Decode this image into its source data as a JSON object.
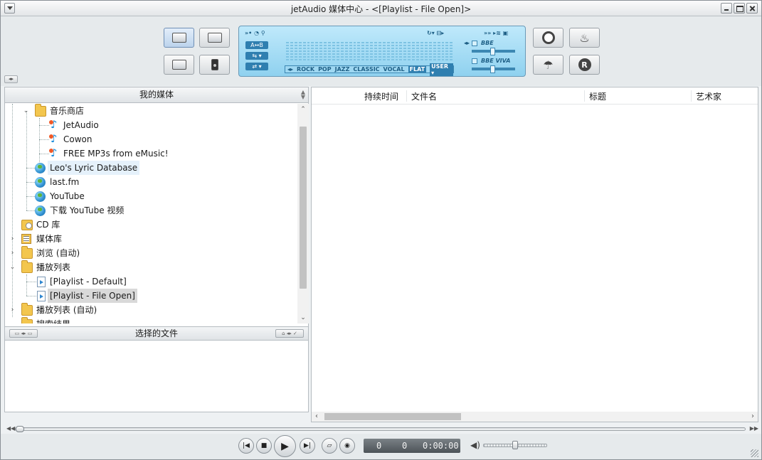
{
  "window": {
    "title": "jetAudio 媒体中心 - <[Playlist - File Open]>"
  },
  "lcd": {
    "ab_label": "A↔B",
    "eq_presets": [
      "ROCK",
      "POP",
      "JAZZ",
      "CLASSIC",
      "VOCAL",
      "FLAT",
      "USER ▾"
    ],
    "eq_selected": "FLAT",
    "bbe_label": "BBE",
    "bbe_viva_label": "BBE VIVA"
  },
  "left_panel": {
    "header": "我的媒体",
    "tree": [
      {
        "label": "音乐商店",
        "icon": "music-store-folder-icon",
        "expanded": true
      },
      {
        "label": "JetAudio",
        "icon": "music-note-icon"
      },
      {
        "label": "Cowon",
        "icon": "music-note-icon"
      },
      {
        "label": "FREE MP3s from eMusic!",
        "icon": "music-note-icon"
      },
      {
        "label": "Leo's Lyric Database",
        "icon": "globe-icon",
        "hover": true
      },
      {
        "label": "last.fm",
        "icon": "globe-icon"
      },
      {
        "label": "YouTube",
        "icon": "globe-icon"
      },
      {
        "label": "下载 YouTube 视频",
        "icon": "globe-icon"
      },
      {
        "label": "CD 库",
        "icon": "cd-folder-icon"
      },
      {
        "label": "媒体库",
        "icon": "library-folder-icon"
      },
      {
        "label": "浏览 (自动)",
        "icon": "browse-folder-icon"
      },
      {
        "label": "播放列表",
        "icon": "playlist-folder-icon",
        "expanded": true
      },
      {
        "label": "[Playlist - Default]",
        "icon": "playlist-file-icon"
      },
      {
        "label": "[Playlist - File Open]",
        "icon": "playlist-file-icon",
        "selected": true
      },
      {
        "label": "播放列表 (自动)",
        "icon": "auto-playlist-folder-icon"
      },
      {
        "label": "搜索结果",
        "icon": "search-results-icon"
      }
    ],
    "selected_files_header": "选择的文件"
  },
  "right_panel": {
    "columns": [
      "持续时间",
      "文件名",
      "标题",
      "艺术家"
    ]
  },
  "transport": {
    "time_a": "0",
    "time_b": "0",
    "time_c": "0:00:00"
  }
}
